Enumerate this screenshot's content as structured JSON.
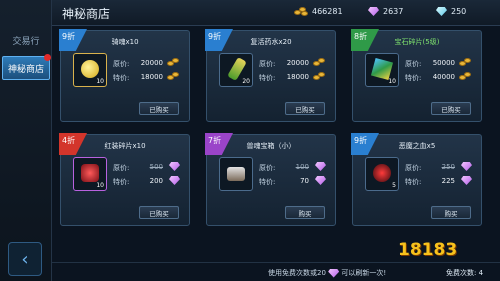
{
  "sidebar": {
    "tabs": [
      "交易行",
      "神秘商店"
    ]
  },
  "header": {
    "title": "神秘商店"
  },
  "currency": {
    "gold": "466281",
    "purple_gem": "2637",
    "diamond": "250"
  },
  "labels": {
    "original_price": "原价:",
    "special_price": "特价:"
  },
  "items": [
    {
      "discount": "9折",
      "name": "骑魂x10",
      "count": "10",
      "original": "20000",
      "special": "18000",
      "currency": "gold-coin-icon",
      "button": "已购买",
      "icon": "gold-coin-icon",
      "ribbon": "#2a7fd0"
    },
    {
      "discount": "9折",
      "name": "复活药水x20",
      "count": "20",
      "original": "20000",
      "special": "18000",
      "currency": "gold-coin-icon",
      "button": "已购买",
      "icon": "potion-bottle-icon",
      "ribbon": "#2a7fd0"
    },
    {
      "discount": "8折",
      "name": "宝石碎片(5级)",
      "count": "10",
      "original": "50000",
      "special": "40000",
      "currency": "gold-coin-icon",
      "button": "已购买",
      "icon": "gem-stone-icon",
      "ribbon": "#2f9a48"
    },
    {
      "discount": "4折",
      "name": "红装碎片x10",
      "count": "10",
      "original": "500",
      "special": "200",
      "currency": "purple-gem-icon",
      "button": "已购买",
      "icon": "red-shard-icon",
      "ribbon": "#d3352b"
    },
    {
      "discount": "7折",
      "name": "兽魂宝箱（小）",
      "count": "",
      "original": "100",
      "special": "70",
      "currency": "purple-gem-icon",
      "button": "购买",
      "icon": "treasure-chest-icon",
      "ribbon": "#9a44c9"
    },
    {
      "discount": "9折",
      "name": "恶魔之血x5",
      "count": "5",
      "original": "250",
      "special": "225",
      "currency": "purple-gem-icon",
      "button": "购买",
      "icon": "demon-blood-icon",
      "ribbon": "#2a7fd0"
    }
  ],
  "footer": {
    "note": "使用免费次数或20",
    "note_tail": "可以刷新一次!",
    "refresh": "免费次数: 4"
  },
  "watermark": "18183"
}
